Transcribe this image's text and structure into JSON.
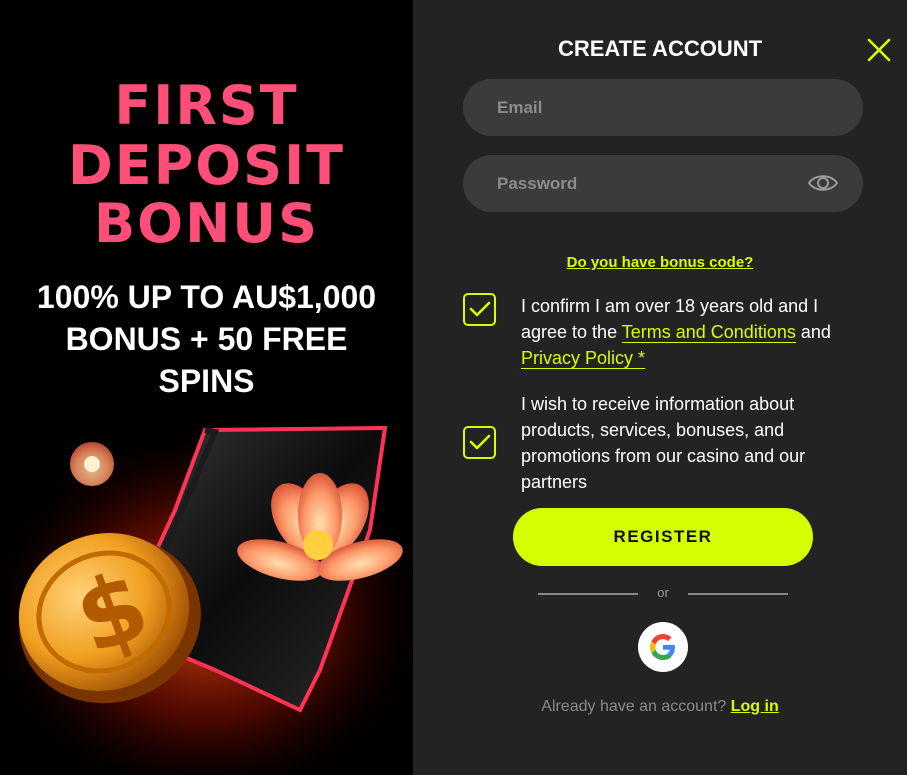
{
  "colors": {
    "accent": "#d4ff00",
    "promo_title": "#ff4f78",
    "panel_bg": "#232323",
    "field_bg": "#3b3b3b"
  },
  "promo": {
    "title_lines": [
      "FIRST",
      "DEPOSIT",
      "BONUS"
    ],
    "subtitle_lines": [
      "100% UP TO AU$1,000",
      "BONUS + 50 FREE",
      "SPINS"
    ]
  },
  "form": {
    "title": "CREATE ACCOUNT",
    "close_icon": "close-icon",
    "email": {
      "placeholder": "Email",
      "value": ""
    },
    "password": {
      "placeholder": "Password",
      "value": "",
      "toggle_icon": "eye-icon"
    },
    "bonus_link": "Do you have bonus code?",
    "consent_age": {
      "checked": true,
      "text_before": "I confirm I am over 18 years old and I agree to the ",
      "terms_link": "Terms and Conditions",
      "text_middle": " and ",
      "privacy_link": "Privacy Policy *"
    },
    "consent_marketing": {
      "checked": true,
      "text": "I wish to receive information about products, services, bonuses, and promotions from our casino and our partners"
    },
    "register_label": "REGISTER",
    "divider_text": "or",
    "google_icon": "google-icon",
    "login_prompt": "Already have an account?",
    "login_link": "Log in"
  }
}
